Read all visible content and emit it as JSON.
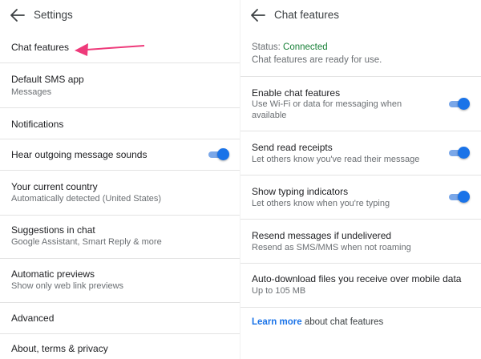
{
  "colors": {
    "accent_blue": "#1a73e8",
    "toggle_track": "#7aa7e8",
    "connected_green": "#188038",
    "arrow_pink": "#ee3a7a",
    "divider": "#e3e3e3"
  },
  "left": {
    "title": "Settings",
    "items": [
      {
        "primary": "Chat features",
        "secondary": ""
      },
      {
        "primary": "Default SMS app",
        "secondary": "Messages"
      },
      {
        "primary": "Notifications",
        "secondary": ""
      },
      {
        "primary": "Hear outgoing message sounds",
        "secondary": "",
        "toggle_on": true
      },
      {
        "primary": "Your current country",
        "secondary": "Automatically detected (United States)"
      },
      {
        "primary": "Suggestions in chat",
        "secondary": "Google Assistant, Smart Reply & more"
      },
      {
        "primary": "Automatic previews",
        "secondary": "Show only web link previews"
      },
      {
        "primary": "Advanced",
        "secondary": ""
      },
      {
        "primary": "About, terms & privacy",
        "secondary": ""
      }
    ]
  },
  "right": {
    "title": "Chat features",
    "status_label": "Status:",
    "status_value": "Connected",
    "status_desc": "Chat features are ready for use.",
    "items": [
      {
        "primary": "Enable chat features",
        "secondary": "Use Wi-Fi or data for messaging when available",
        "toggle_on": true
      },
      {
        "primary": "Send read receipts",
        "secondary": "Let others know you've read their message",
        "toggle_on": true
      },
      {
        "primary": "Show typing indicators",
        "secondary": "Let others know when you're typing",
        "toggle_on": true
      },
      {
        "primary": "Resend messages if undelivered",
        "secondary": "Resend as SMS/MMS when not roaming"
      },
      {
        "primary": "Auto-download files you receive over mobile data",
        "secondary": "Up to 105 MB"
      }
    ],
    "learn_more_link": "Learn more",
    "learn_more_rest": " about chat features"
  }
}
